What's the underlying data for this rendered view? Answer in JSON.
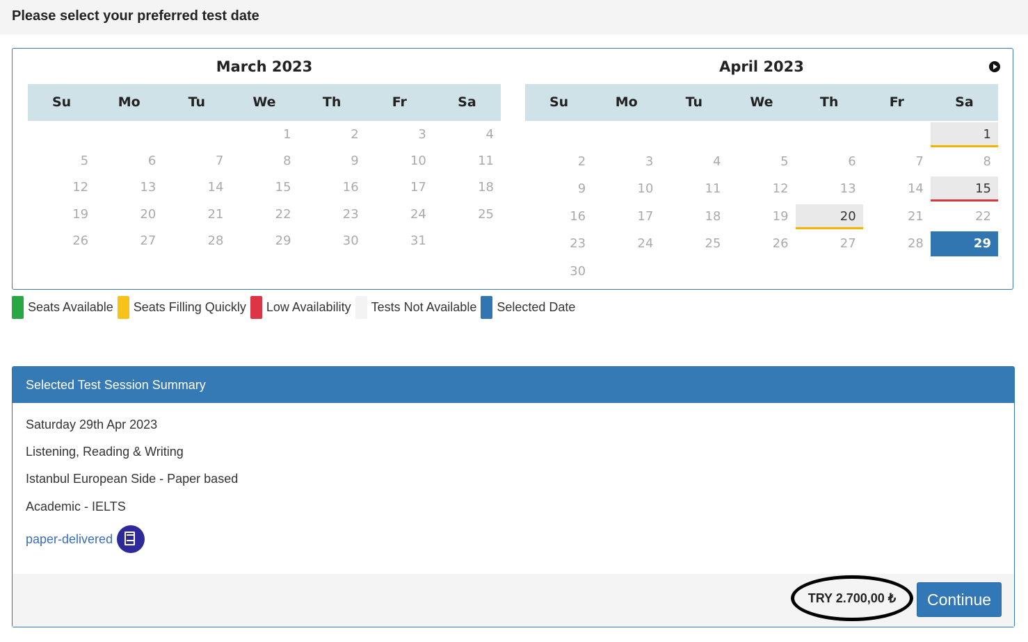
{
  "page_title": "Please select your preferred test date",
  "calendars": {
    "march": {
      "title": "March 2023",
      "weekdays": [
        "Su",
        "Mo",
        "Tu",
        "We",
        "Th",
        "Fr",
        "Sa"
      ],
      "weeks": [
        [
          "",
          "",
          "",
          "1",
          "2",
          "3",
          "4"
        ],
        [
          "5",
          "6",
          "7",
          "8",
          "9",
          "10",
          "11"
        ],
        [
          "12",
          "13",
          "14",
          "15",
          "16",
          "17",
          "18"
        ],
        [
          "19",
          "20",
          "21",
          "22",
          "23",
          "24",
          "25"
        ],
        [
          "26",
          "27",
          "28",
          "29",
          "30",
          "31",
          ""
        ]
      ]
    },
    "april": {
      "title": "April 2023",
      "weekdays": [
        "Su",
        "Mo",
        "Tu",
        "We",
        "Th",
        "Fr",
        "Sa"
      ],
      "weeks": [
        [
          "",
          "",
          "",
          "",
          "",
          "",
          "1"
        ],
        [
          "2",
          "3",
          "4",
          "5",
          "6",
          "7",
          "8"
        ],
        [
          "9",
          "10",
          "11",
          "12",
          "13",
          "14",
          "15"
        ],
        [
          "16",
          "17",
          "18",
          "19",
          "20",
          "21",
          "22"
        ],
        [
          "23",
          "24",
          "25",
          "26",
          "27",
          "28",
          "29"
        ],
        [
          "30",
          "",
          "",
          "",
          "",
          "",
          ""
        ]
      ],
      "day_status": {
        "1": "seats-filling-quickly",
        "15": "low-availability",
        "20": "seats-filling-quickly",
        "29": "selected"
      }
    }
  },
  "legend": [
    {
      "label": "Seats Available",
      "color": "#28a745"
    },
    {
      "label": "Seats Filling Quickly",
      "color": "#f7c31b"
    },
    {
      "label": "Low Availability",
      "color": "#dc3545"
    },
    {
      "label": "Tests Not Available",
      "color": "#f3f3f3"
    },
    {
      "label": "Selected Date",
      "color": "#3276b1"
    }
  ],
  "summary": {
    "heading": "Selected Test Session Summary",
    "date": "Saturday 29th Apr 2023",
    "modules": "Listening, Reading & Writing",
    "location": "Istanbul European Side - Paper based",
    "test_type": "Academic - IELTS",
    "delivery_label": "paper-delivered",
    "price": "TRY 2.700,00 ₺",
    "continue_label": "Continue"
  }
}
